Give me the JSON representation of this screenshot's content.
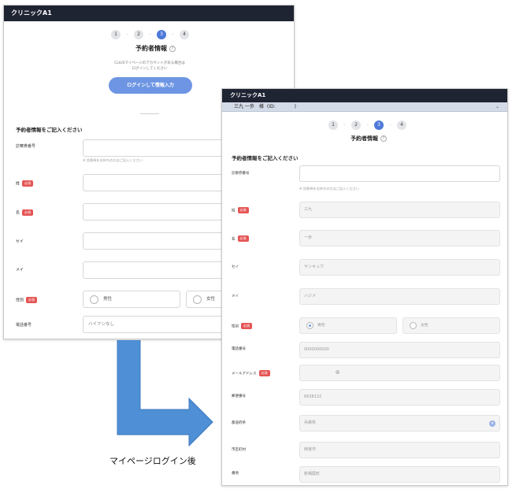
{
  "screen_a": {
    "app_title": "クリニックA1",
    "steps": [
      "1",
      "2",
      "3",
      "4"
    ],
    "active_step": "3",
    "page_title": "予約者情報",
    "login_note_line1": "CLIUSマイページのアカウントがある場合は",
    "login_note_line2": "ログインしてください",
    "login_button": "ログインして情報入力",
    "section_title": "予約者情報をご記入ください",
    "form": {
      "patient_no_label": "診察券番号",
      "patient_no_hint": "※ 診察券をお持ちの方はご記入ください",
      "last_name_label": "姓",
      "first_name_label": "名",
      "last_kana_label": "セイ",
      "first_kana_label": "メイ",
      "gender_label": "性別",
      "gender_male": "男性",
      "gender_female": "女性",
      "phone_label": "電話番号",
      "phone_placeholder": "ハイフンなし",
      "required_badge": "必須"
    }
  },
  "screen_b": {
    "app_title": "クリニックA1",
    "user_name": "三九 一歩　様",
    "user_id": "(ID:　　　　)",
    "steps": [
      "1",
      "2",
      "3",
      "4"
    ],
    "active_step": "3",
    "page_title": "予約者情報",
    "section_title": "予約者情報をご記入ください",
    "form": {
      "patient_no_label": "診察券番号",
      "patient_no_hint": "※ 診察券をお持ちの方はご記入ください",
      "last_name_label": "姓",
      "last_name_value": "三九",
      "first_name_label": "名",
      "first_name_value": "一歩",
      "last_kana_label": "セイ",
      "last_kana_value": "サンキュウ",
      "first_kana_label": "メイ",
      "first_kana_value": "ハジメ",
      "gender_label": "性別",
      "gender_male": "男性",
      "gender_female": "女性",
      "phone_label": "電話番号",
      "phone_value": "0000000000",
      "email_label": "メールアドレス",
      "email_at": "@",
      "postal_label": "郵便番号",
      "postal_value": "6638132",
      "prefecture_label": "都道府県",
      "prefecture_value": "兵庫県",
      "city_label": "市区町村",
      "city_value": "西宮市",
      "address_label": "番地",
      "address_value": "新鳴尾町",
      "required_badge": "必須"
    }
  },
  "caption": "マイページログイン後",
  "colors": {
    "appbar": "#1f2433",
    "accent": "#4f79d9",
    "button": "#6d95e3",
    "required": "#e55454",
    "arrow": "#4f8fd6"
  }
}
